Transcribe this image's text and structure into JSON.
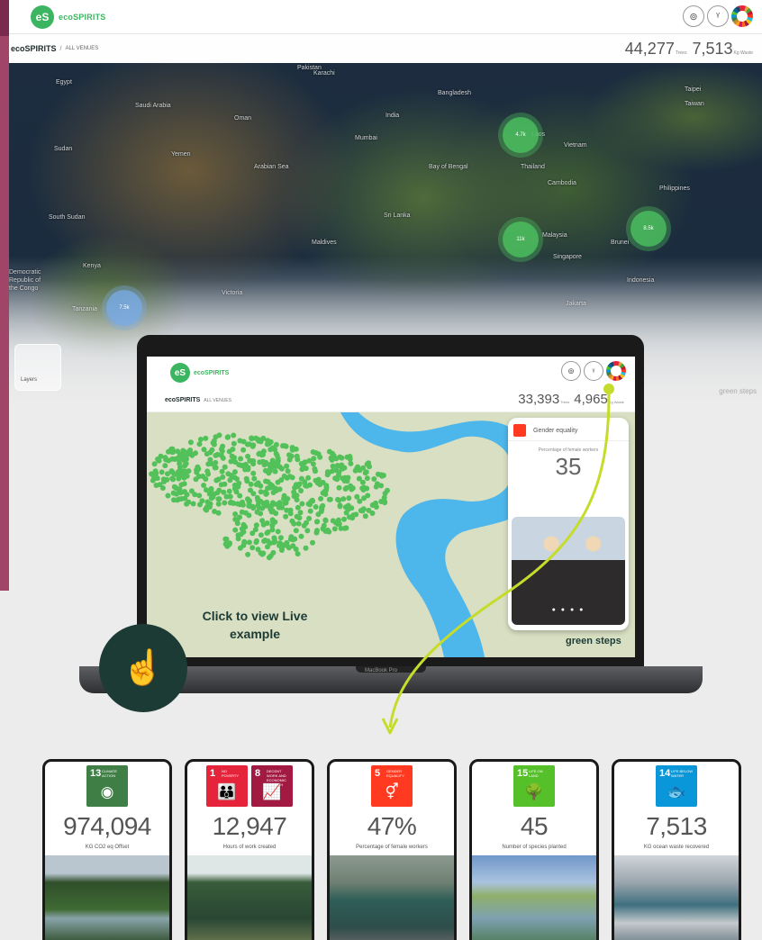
{
  "header": {
    "logo_mark": "eS",
    "logo_text": "ecoSPIRITS",
    "icons": [
      "location-leaf-icon",
      "sprout-icon",
      "sdg-wheel-icon"
    ]
  },
  "subheader": {
    "brand": "ecoSPIRITS",
    "separator": "/",
    "location": "ALL VENUES",
    "trees_value": "44,277",
    "trees_label": "Trees",
    "waste_value": "7,513",
    "waste_label": "Kg Waste"
  },
  "map": {
    "labels": [
      "Pakistan",
      "Egypt",
      "Saudi Arabia",
      "Oman",
      "Yemen",
      "Sudan",
      "South Sudan",
      "Kenya",
      "India",
      "Bangladesh",
      "Arabian Sea",
      "Bay of Bengal",
      "Sri Lanka",
      "Maldives",
      "Laos",
      "Thailand",
      "Vietnam",
      "Cambodia",
      "Philippines",
      "Malaysia",
      "Singapore",
      "Indonesia",
      "Brunei",
      "Taipei",
      "Taiwan",
      "Karachi",
      "Mumbai",
      "Victoria",
      "Jakarta",
      "Democratic Republic of the Congo",
      "Tanzania"
    ],
    "clusters": [
      "4.7k",
      "11k",
      "8.5k",
      "7.5k"
    ],
    "layers_label": "Layers",
    "watermark": "green steps"
  },
  "laptop": {
    "logo_mark": "eS",
    "logo_text": "ecoSPIRITS",
    "brand": "ecoSPIRITS",
    "location": "ALL VENUES",
    "trees_value": "33,393",
    "trees_label": "Trees",
    "waste_value": "4,965",
    "waste_label": "Kg Waste",
    "sdg_card": {
      "title": "Gender equality",
      "subtitle": "Percentage of female workers",
      "value": "35",
      "pager": "● ● ● ●"
    },
    "cta": "Click to view Live example",
    "brand_footer": "green steps",
    "base_label": "MacBook Pro"
  },
  "tiles": [
    {
      "badges": [
        {
          "num": "13",
          "text": "CLIMATE ACTION",
          "color": "#3f7e44",
          "glyph": "◉"
        }
      ],
      "value": "974,094",
      "label": "KG CO2 eq Offset",
      "image": "mangrove-aerial"
    },
    {
      "badges": [
        {
          "num": "1",
          "text": "NO POVERTY",
          "color": "#e5243b",
          "glyph": "👪"
        },
        {
          "num": "8",
          "text": "DECENT WORK AND ECONOMIC GROWTH",
          "color": "#a21942",
          "glyph": "📈"
        }
      ],
      "value": "12,947",
      "label": "Hours of work created",
      "image": "planting-team"
    },
    {
      "badges": [
        {
          "num": "5",
          "text": "GENDER EQUALITY",
          "color": "#ff3a21",
          "glyph": "⚥"
        }
      ],
      "value": "47%",
      "label": "Percentage of female workers",
      "image": "female-workers"
    },
    {
      "badges": [
        {
          "num": "15",
          "text": "LIFE ON LAND",
          "color": "#56c02b",
          "glyph": "🌳"
        }
      ],
      "value": "45",
      "label": "Number of species planted",
      "image": "mangrove-seedlings"
    },
    {
      "badges": [
        {
          "num": "14",
          "text": "LIFE BELOW WATER",
          "color": "#0a97d9",
          "glyph": "🐟"
        }
      ],
      "value": "7,513",
      "label": "KG ocean waste recovered",
      "image": "waste-collection"
    }
  ],
  "colors": {
    "brand_green": "#3cb560",
    "dark_teal": "#1d3b35",
    "arrow": "#c5dc2a",
    "side_strip": "#a04468"
  }
}
